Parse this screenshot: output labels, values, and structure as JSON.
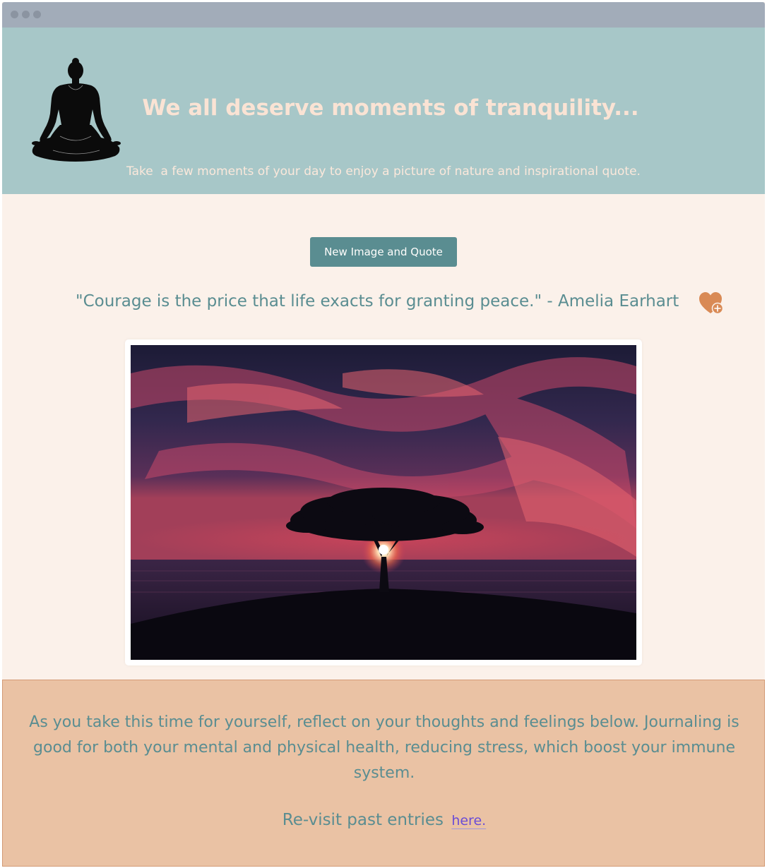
{
  "header": {
    "headline": "We all deserve moments of tranquility...",
    "subline": "Take  a few moments of your day to enjoy a picture of nature and inspirational quote."
  },
  "controls": {
    "new_button_label": "New Image and Quote"
  },
  "quote": {
    "text": "\"Courage is the price that life exacts for granting peace.\" - Amelia Earhart"
  },
  "journal": {
    "prompt": "As you take this time for yourself, reflect on your thoughts and feelings below. Journaling is good for both your mental and physical health, reducing stress, which boost your immune system.",
    "revisit_text": "Re-visit past entries",
    "revisit_link": "here."
  },
  "icons": {
    "header_figure": "meditation-figure-icon",
    "favorite": "heart-plus-icon"
  },
  "colors": {
    "header_bg": "#a7c7c8",
    "page_bg": "#fbf1ea",
    "accent_teal": "#5a8d91",
    "journal_bg": "#eac2a4",
    "favorite": "#d98a55",
    "link": "#6a4cd6"
  }
}
